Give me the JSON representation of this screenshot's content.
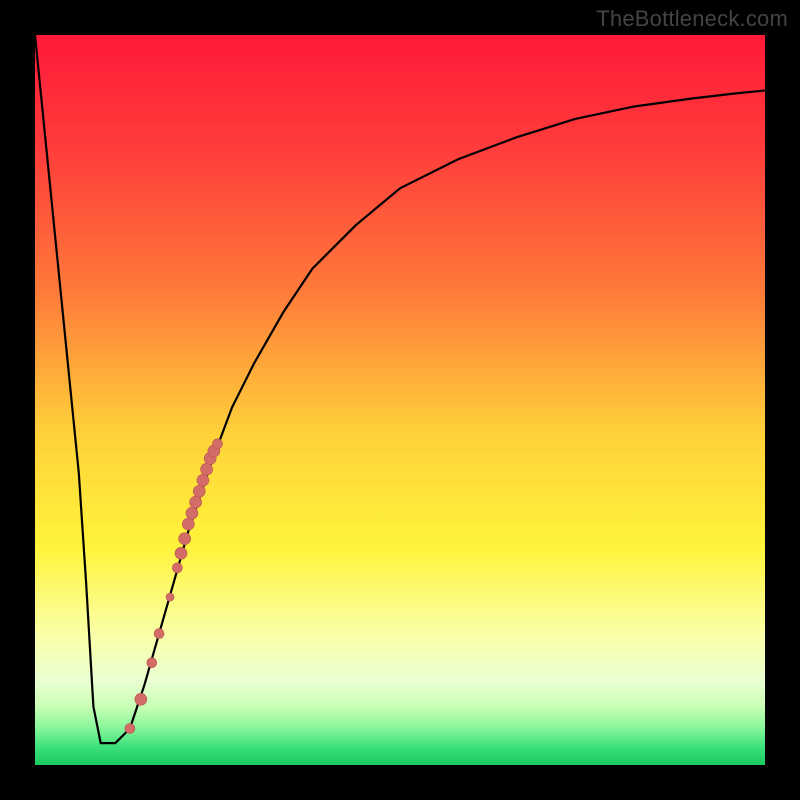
{
  "watermark": "TheBottleneck.com",
  "colors": {
    "frame": "#000000",
    "curve": "#000000",
    "dot_fill": "#d36b66",
    "dot_stroke": "#b85650",
    "gradient_stops": [
      {
        "offset": 0.0,
        "color": "#ff1a38"
      },
      {
        "offset": 0.15,
        "color": "#ff3b3b"
      },
      {
        "offset": 0.35,
        "color": "#ff7a3a"
      },
      {
        "offset": 0.55,
        "color": "#ffd23a"
      },
      {
        "offset": 0.7,
        "color": "#fff43a"
      },
      {
        "offset": 0.82,
        "color": "#faffa6"
      },
      {
        "offset": 0.885,
        "color": "#eaffd2"
      },
      {
        "offset": 0.92,
        "color": "#c8ffb4"
      },
      {
        "offset": 0.95,
        "color": "#86f59a"
      },
      {
        "offset": 0.975,
        "color": "#3de27a"
      },
      {
        "offset": 1.0,
        "color": "#17c95e"
      }
    ]
  },
  "chart_data": {
    "type": "line",
    "title": "",
    "xlabel": "",
    "ylabel": "",
    "xlim": [
      0,
      100
    ],
    "ylim": [
      0,
      100
    ],
    "grid": false,
    "series": [
      {
        "name": "bottleneck-curve",
        "x": [
          0.0,
          2.0,
          4.0,
          6.0,
          7.0,
          8.0,
          9.0,
          10.0,
          11.0,
          13.0,
          15.0,
          17.0,
          19.0,
          21.0,
          24.0,
          27.0,
          30.0,
          34.0,
          38.0,
          44.0,
          50.0,
          58.0,
          66.0,
          74.0,
          82.0,
          90.0,
          96.0,
          100.0
        ],
        "y": [
          100.0,
          80.0,
          60.0,
          40.0,
          25.0,
          8.0,
          3.0,
          3.0,
          3.0,
          5.0,
          11.0,
          18.0,
          25.0,
          32.0,
          41.0,
          49.0,
          55.0,
          62.0,
          68.0,
          74.0,
          79.0,
          83.0,
          86.0,
          88.5,
          90.2,
          91.3,
          92.0,
          92.4
        ]
      }
    ],
    "dots": {
      "name": "highlighted-points",
      "points": [
        {
          "x": 13.0,
          "y": 5.0,
          "r": 5
        },
        {
          "x": 14.5,
          "y": 9.0,
          "r": 6
        },
        {
          "x": 16.0,
          "y": 14.0,
          "r": 5
        },
        {
          "x": 17.0,
          "y": 18.0,
          "r": 5
        },
        {
          "x": 18.5,
          "y": 23.0,
          "r": 4
        },
        {
          "x": 19.5,
          "y": 27.0,
          "r": 5
        },
        {
          "x": 20.0,
          "y": 29.0,
          "r": 6
        },
        {
          "x": 20.5,
          "y": 31.0,
          "r": 6
        },
        {
          "x": 21.0,
          "y": 33.0,
          "r": 6
        },
        {
          "x": 21.5,
          "y": 34.5,
          "r": 6
        },
        {
          "x": 22.0,
          "y": 36.0,
          "r": 6
        },
        {
          "x": 22.5,
          "y": 37.5,
          "r": 6
        },
        {
          "x": 23.0,
          "y": 39.0,
          "r": 6
        },
        {
          "x": 23.5,
          "y": 40.5,
          "r": 6
        },
        {
          "x": 24.0,
          "y": 42.0,
          "r": 6
        },
        {
          "x": 24.5,
          "y": 43.0,
          "r": 6
        },
        {
          "x": 25.0,
          "y": 44.0,
          "r": 5
        }
      ]
    }
  }
}
